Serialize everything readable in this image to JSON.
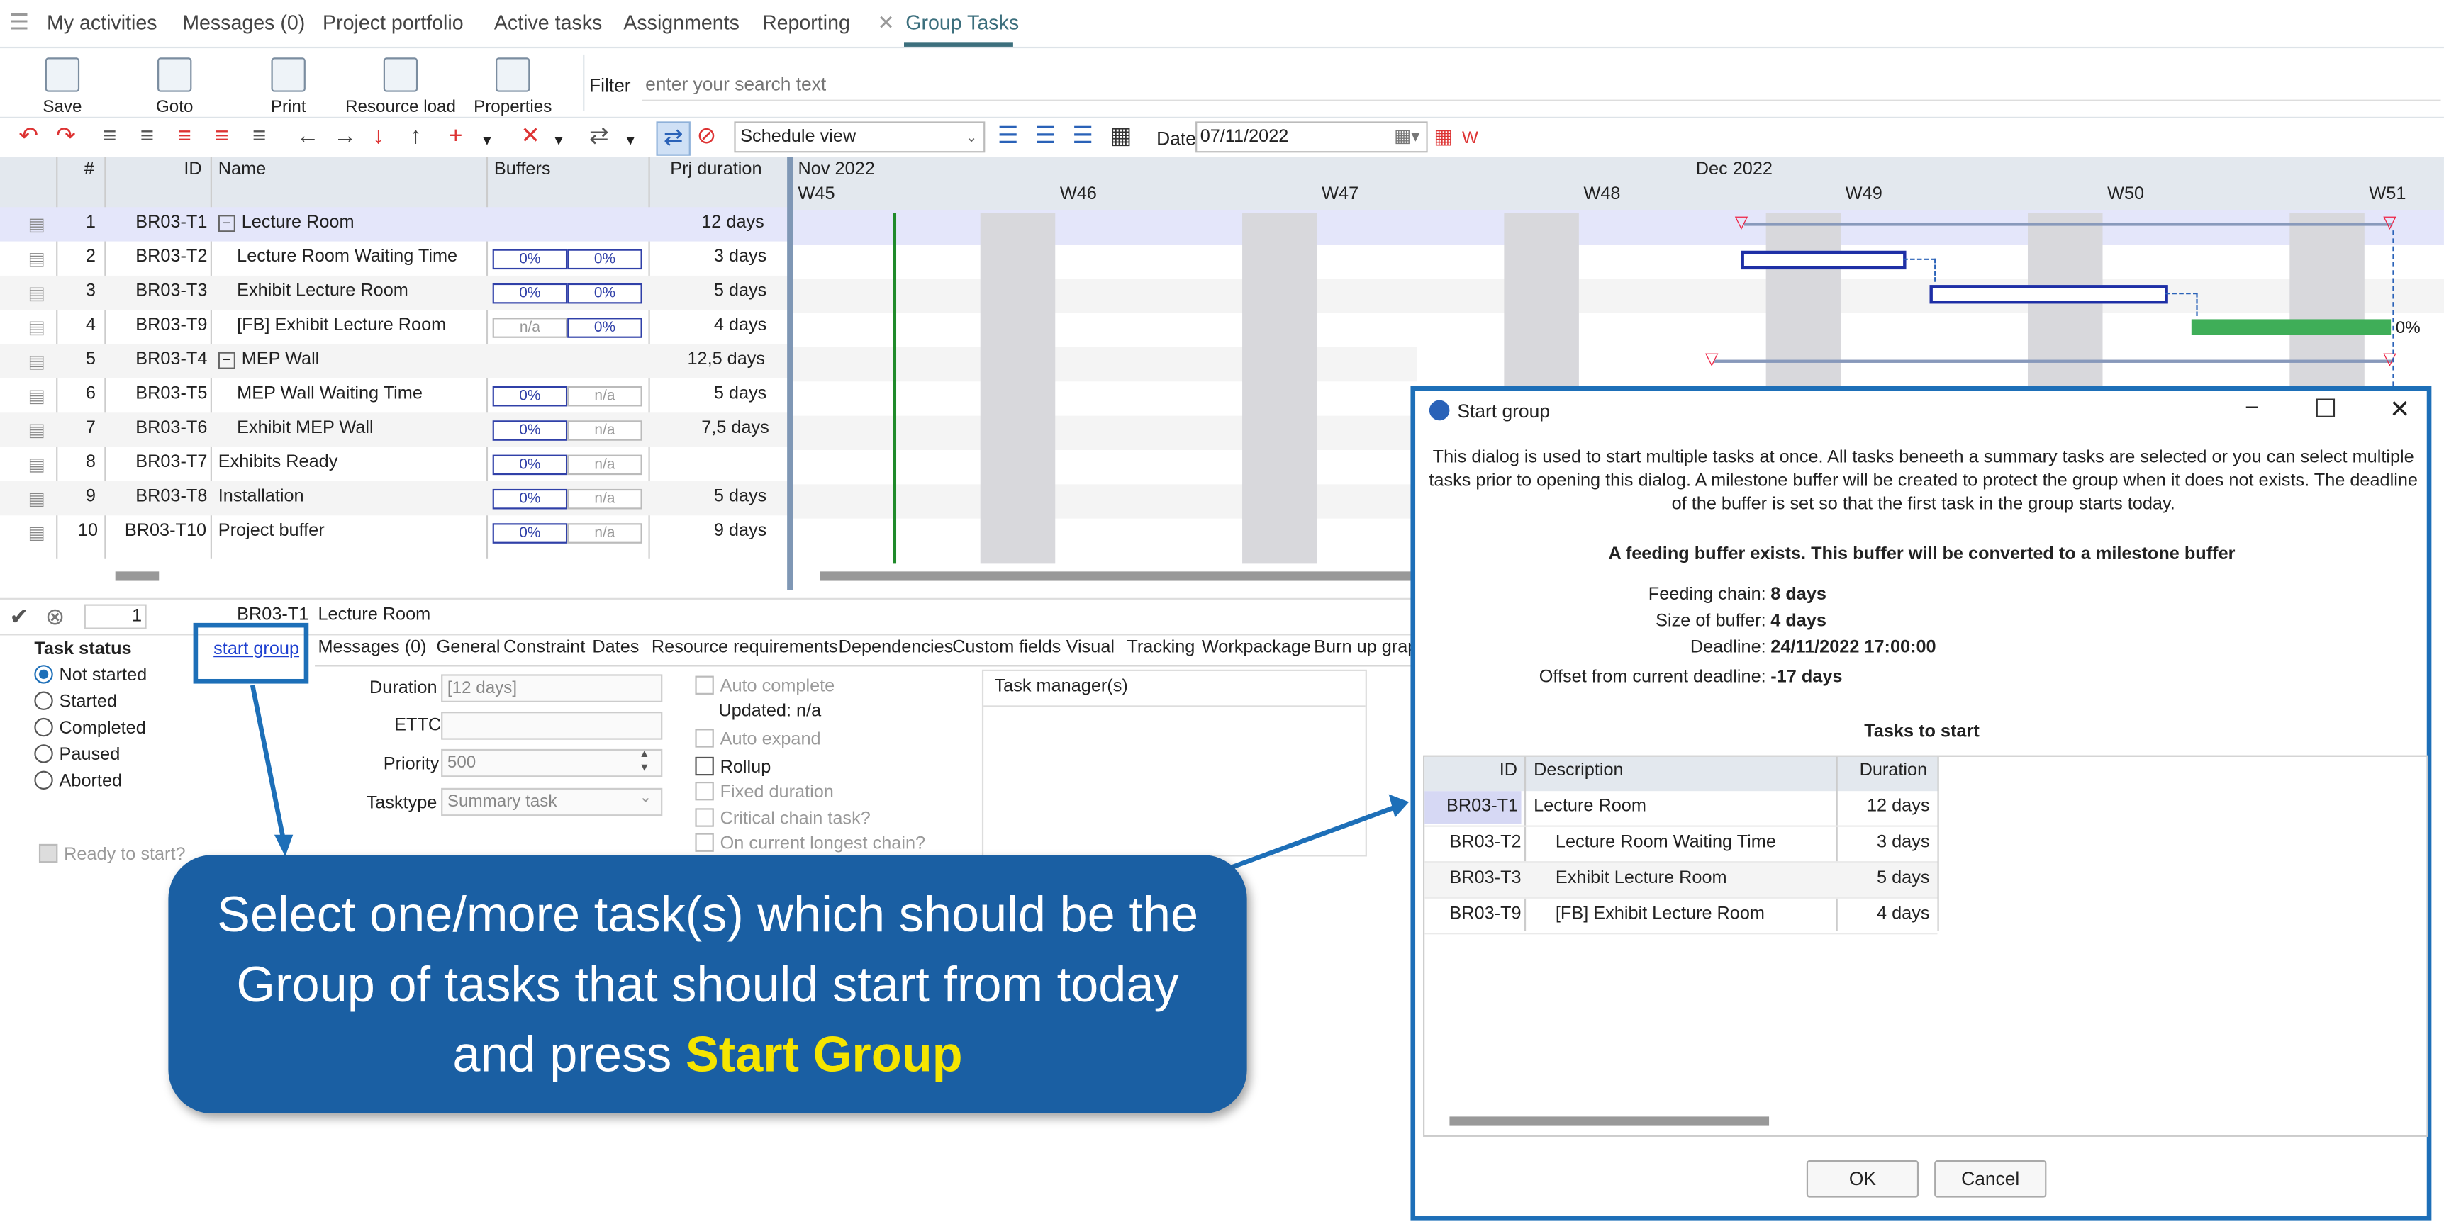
{
  "nav": {
    "items": [
      "My activities",
      "Messages (0)",
      "Project portfolio",
      "Active tasks",
      "Assignments",
      "Reporting"
    ],
    "active_tab": "Group Tasks"
  },
  "toolbar": {
    "save": "Save",
    "goto": "Goto",
    "print": "Print",
    "resource_load": "Resource load",
    "properties": "Properties",
    "filter_label": "Filter",
    "filter_placeholder": "enter your search text",
    "view_select": "Schedule view",
    "date_label": "Date",
    "date_value": "07/11/2022"
  },
  "grid": {
    "headers": {
      "num": "#",
      "id": "ID",
      "name": "Name",
      "buffers": "Buffers",
      "duration": "Prj duration"
    },
    "rows": [
      {
        "n": "1",
        "id": "BR03-T1",
        "name": "Lecture Room",
        "b1": "",
        "b2": "",
        "dur": "12 days"
      },
      {
        "n": "2",
        "id": "BR03-T2",
        "name": "Lecture Room Waiting Time",
        "b1": "0%",
        "b2": "0%",
        "dur": "3 days"
      },
      {
        "n": "3",
        "id": "BR03-T3",
        "name": "Exhibit Lecture Room",
        "b1": "0%",
        "b2": "0%",
        "dur": "5 days"
      },
      {
        "n": "4",
        "id": "BR03-T9",
        "name": "[FB]  Exhibit Lecture Room",
        "b1": "n/a",
        "b2": "0%",
        "dur": "4 days"
      },
      {
        "n": "5",
        "id": "BR03-T4",
        "name": "MEP Wall",
        "b1": "",
        "b2": "",
        "dur": "12,5 days"
      },
      {
        "n": "6",
        "id": "BR03-T5",
        "name": "MEP Wall Waiting Time",
        "b1": "0%",
        "b2": "n/a",
        "dur": "5 days"
      },
      {
        "n": "7",
        "id": "BR03-T6",
        "name": "Exhibit MEP Wall",
        "b1": "0%",
        "b2": "n/a",
        "dur": "7,5 days"
      },
      {
        "n": "8",
        "id": "BR03-T7",
        "name": "Exhibits Ready",
        "b1": "0%",
        "b2": "n/a",
        "dur": ""
      },
      {
        "n": "9",
        "id": "BR03-T8",
        "name": "Installation",
        "b1": "0%",
        "b2": "n/a",
        "dur": "5 days"
      },
      {
        "n": "10",
        "id": "BR03-T10",
        "name": "Project buffer",
        "b1": "0%",
        "b2": "n/a",
        "dur": "9 days"
      }
    ]
  },
  "gantt": {
    "month1": "Nov 2022",
    "month2": "Dec 2022",
    "weeks": [
      "W45",
      "W46",
      "W47",
      "W48",
      "W49",
      "W50",
      "W51"
    ],
    "bar_label": "0%"
  },
  "detail": {
    "row_num": "1",
    "row_id": "BR03-T1",
    "row_name": "Lecture Room",
    "task_status_title": "Task status",
    "statuses": [
      "Not started",
      "Started",
      "Completed",
      "Paused",
      "Aborted"
    ],
    "start_group_link": "start group",
    "ready_label": "Ready to start?",
    "tabs": [
      "Messages (0)",
      "General",
      "Constraint",
      "Dates",
      "Resource requirements",
      "Dependencies",
      "Custom fields",
      "Visual",
      "Tracking",
      "Workpackage",
      "Burn up grap"
    ],
    "duration_label": "Duration",
    "duration_value": "[12 days]",
    "ettc_label": "ETTC",
    "priority_label": "Priority",
    "priority_value": "500",
    "tasktype_label": "Tasktype",
    "tasktype_value": "Summary task",
    "auto_complete": "Auto complete",
    "updated": "Updated: n/a",
    "auto_expand": "Auto expand",
    "rollup": "Rollup",
    "fixed_duration": "Fixed duration",
    "critical_chain": "Critical chain task?",
    "longest_chain": "On current longest chain?",
    "task_manager": "Task manager(s)"
  },
  "dialog": {
    "title": "Start group",
    "intro": "This dialog is used to start multiple tasks at once. All tasks beneeth a summary tasks are selected or you can select multiple tasks prior to opening this dialog. A milestone buffer will be created to protect the group when it does not exists. The deadline of the buffer is set so that the first task in the group starts today.",
    "heading": "A feeding buffer exists. This buffer will be converted to a milestone buffer",
    "feeding_chain_label": "Feeding chain:",
    "feeding_chain_value": "8 days",
    "size_label": "Size of buffer:",
    "size_value": "4 days",
    "deadline_label": "Deadline:",
    "deadline_value": "24/11/2022 17:00:00",
    "offset_label": "Offset from current deadline:",
    "offset_value": "-17 days",
    "tasks_title": "Tasks to start",
    "col_id": "ID",
    "col_desc": "Description",
    "col_dur": "Duration",
    "tasks": [
      {
        "id": "BR03-T1",
        "desc": "Lecture Room",
        "dur": "12 days"
      },
      {
        "id": "BR03-T2",
        "desc": "Lecture Room Waiting Time",
        "dur": "3 days"
      },
      {
        "id": "BR03-T3",
        "desc": "Exhibit Lecture Room",
        "dur": "5 days"
      },
      {
        "id": "BR03-T9",
        "desc": "[FB]  Exhibit Lecture Room",
        "dur": "4 days"
      }
    ],
    "ok": "OK",
    "cancel": "Cancel"
  },
  "callout": {
    "text": "Select one/more task(s) which should be the Group of tasks that should start from today and press",
    "highlight": "Start Group"
  },
  "colors": {
    "accent": "#1d6fb8",
    "callout_bg": "#1a5fa3",
    "highlight": "#f5e500",
    "green_bar": "#3fae58"
  }
}
